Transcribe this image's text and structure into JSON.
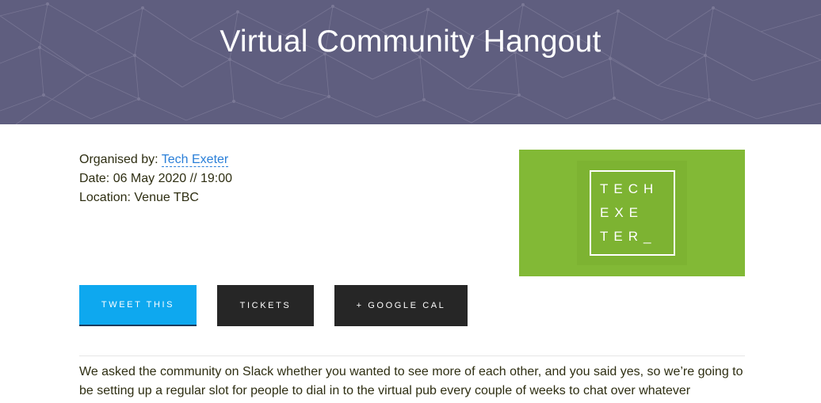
{
  "header": {
    "title": "Virtual Community Hangout"
  },
  "meta": {
    "organiser_label": "Organised by: ",
    "organiser_name": "Tech Exeter",
    "date": "Date: 06 May 2020 // 19:00",
    "location": "Location: Venue TBC"
  },
  "logo": {
    "lines": [
      "TECH",
      "EXE",
      "TER_"
    ],
    "background": "#82b936"
  },
  "buttons": {
    "tweet": "TWEET THIS",
    "tickets": "TICKETS",
    "gcal": "+ GOOGLE CAL"
  },
  "description": "We asked the community on Slack whether you wanted to see more of each other, and you said yes, so we’re going to be setting up a regular slot for people to dial in to the virtual pub every couple of weeks to chat over whatever",
  "colors": {
    "hero": "#5f5e7f",
    "tweet_button": "#0ea8ef",
    "dark_button": "#262626",
    "link": "#2a7fd8"
  }
}
